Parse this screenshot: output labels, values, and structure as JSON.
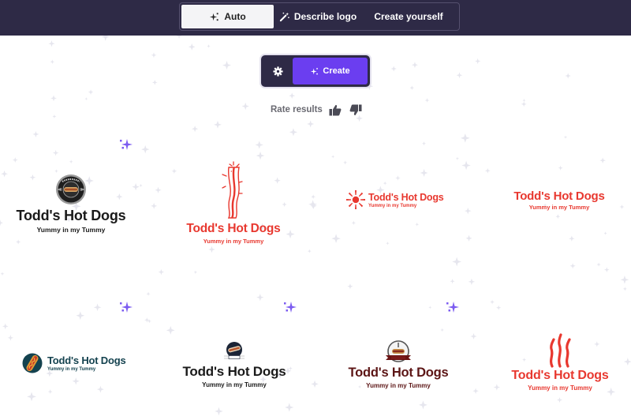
{
  "mode_tabs": [
    {
      "label": "Auto",
      "icon": "sparkles-icon",
      "active": true
    },
    {
      "label": "Describe logo",
      "icon": "magic-wand-icon",
      "active": false
    },
    {
      "label": "Create yourself",
      "icon": null,
      "active": false
    }
  ],
  "actions": {
    "settings_icon": "gear-icon",
    "create_label": "Create",
    "create_icon": "sparkles-icon"
  },
  "rating": {
    "label": "Rate results",
    "up_icon": "thumbs-up-icon",
    "down_icon": "thumbs-down-icon"
  },
  "colors": {
    "topbar": "#2e2a46",
    "accent_purple": "#6b3ef0",
    "sparkle_accent": "#7c5cf0",
    "logo_red": "#e8382f",
    "logo_black": "#1a1a1a",
    "logo_teal": "#14424f",
    "logo_maroon": "#5c1515"
  },
  "logos": [
    {
      "title": "Todd's Hot Dogs",
      "tagline": "Yummy in my Tummy",
      "emblem": "round-hotdog-badge-icon",
      "color": "#1a1a1a"
    },
    {
      "title": "Todd's Hot Dogs",
      "tagline": "Yummy in my Tummy",
      "emblem": "bacon-strip-icon",
      "color": "#e8382f"
    },
    {
      "title": "Todd's Hot Dogs",
      "tagline": "Yummy in my Tummy",
      "emblem": "sunburst-icon",
      "color": "#e8382f"
    },
    {
      "title": "Todd's Hot Dogs",
      "tagline": "Yummy in my Tummy",
      "emblem": null,
      "color": "#e8382f"
    },
    {
      "title": "Todd's Hot Dogs",
      "tagline": "Yummy in my Tummy",
      "emblem": "hotdog-circle-icon",
      "color": "#14424f"
    },
    {
      "title": "Todd's Hot Dogs",
      "tagline": "Yummy in my Tummy",
      "emblem": "hotdog-badge-icon",
      "color": "#1a1a1a"
    },
    {
      "title": "Todd's Hot Dogs",
      "tagline": "Yummy in my Tummy",
      "emblem": "hotdog-ribbon-badge-icon",
      "color": "#5c1515"
    },
    {
      "title": "Todd's Hot Dogs",
      "tagline": "Yummy in my Tummy",
      "emblem": "steam-flames-icon",
      "color": "#e8382f"
    }
  ]
}
